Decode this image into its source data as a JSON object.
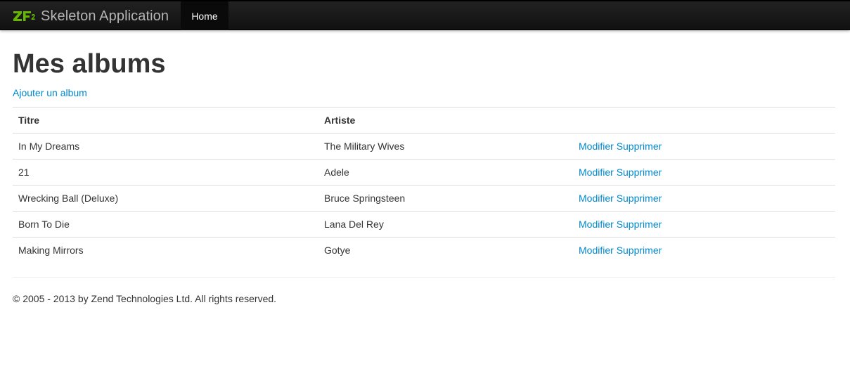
{
  "navbar": {
    "brand_logo_text": "ZF2",
    "brand_text": "Skeleton Application",
    "home_label": "Home"
  },
  "main": {
    "title": "Mes albums",
    "add_link": "Ajouter un album",
    "table": {
      "headers": [
        "Titre",
        "Artiste",
        ""
      ],
      "rows": [
        {
          "title": "In My Dreams",
          "artist": "The Military Wives",
          "edit": "Modifier",
          "delete": "Supprimer"
        },
        {
          "title": "21",
          "artist": "Adele",
          "edit": "Modifier",
          "delete": "Supprimer"
        },
        {
          "title": "Wrecking Ball (Deluxe)",
          "artist": "Bruce Springsteen",
          "edit": "Modifier",
          "delete": "Supprimer"
        },
        {
          "title": "Born To Die",
          "artist": "Lana Del Rey",
          "edit": "Modifier",
          "delete": "Supprimer"
        },
        {
          "title": "Making Mirrors",
          "artist": "Gotye",
          "edit": "Modifier",
          "delete": "Supprimer"
        }
      ]
    }
  },
  "footer": {
    "text": "© 2005 - 2013 by Zend Technologies Ltd. All rights reserved."
  },
  "colors": {
    "link": "#0088cc",
    "navbar": "#1b1b1b",
    "logo_green": "#68b604"
  }
}
